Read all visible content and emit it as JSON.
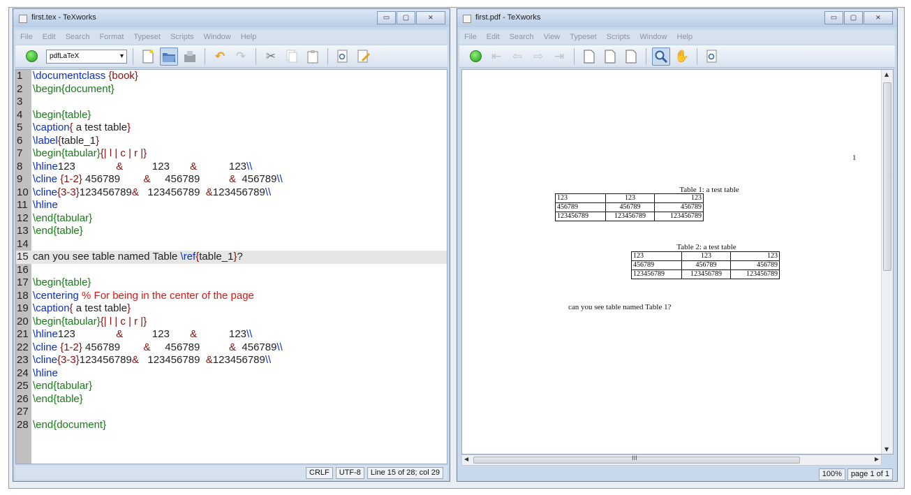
{
  "left": {
    "title": "first.tex - TeXworks",
    "menus": [
      "File",
      "Edit",
      "Search",
      "Format",
      "Typeset",
      "Scripts",
      "Window",
      "Help"
    ],
    "engine": "pdfLaTeX",
    "status": {
      "eol": "CRLF",
      "encoding": "UTF-8",
      "position": "Line 15 of 28; col 29"
    },
    "line_numbers": [
      "1",
      "2",
      "3",
      "4",
      "5",
      "6",
      "7",
      "8",
      "9",
      "10",
      "11",
      "12",
      "13",
      "14",
      "15",
      "16",
      "17",
      "18",
      "19",
      "20",
      "21",
      "22",
      "23",
      "24",
      "25",
      "26",
      "27",
      "28"
    ],
    "code": [
      [
        {
          "t": "\\documentclass ",
          "c": "k"
        },
        {
          "t": "{book}",
          "c": "a"
        }
      ],
      [
        {
          "t": "\\begin",
          "c": "e"
        },
        {
          "t": "{document}",
          "c": "e"
        }
      ],
      [],
      [
        {
          "t": "\\begin",
          "c": "e"
        },
        {
          "t": "{table}",
          "c": "e"
        }
      ],
      [
        {
          "t": "\\caption",
          "c": "k"
        },
        {
          "t": "{",
          "c": "a"
        },
        {
          "t": " a test table",
          "c": "t"
        },
        {
          "t": "}",
          "c": "a"
        }
      ],
      [
        {
          "t": "\\label",
          "c": "k"
        },
        {
          "t": "{",
          "c": "a"
        },
        {
          "t": "table_1",
          "c": "t"
        },
        {
          "t": "}",
          "c": "a"
        }
      ],
      [
        {
          "t": "\\begin",
          "c": "e"
        },
        {
          "t": "{tabular}",
          "c": "e"
        },
        {
          "t": "{| l | c | r |}",
          "c": "a"
        }
      ],
      [
        {
          "t": "\\hline",
          "c": "k"
        },
        {
          "t": "123              ",
          "c": "t"
        },
        {
          "t": "&",
          "c": "a"
        },
        {
          "t": "          123       ",
          "c": "t"
        },
        {
          "t": "&",
          "c": "a"
        },
        {
          "t": "           123",
          "c": "t"
        },
        {
          "t": "\\\\",
          "c": "k"
        }
      ],
      [
        {
          "t": "\\cline ",
          "c": "k"
        },
        {
          "t": "{1-2}",
          "c": "a"
        },
        {
          "t": " 456789        ",
          "c": "t"
        },
        {
          "t": "&",
          "c": "a"
        },
        {
          "t": "     456789          ",
          "c": "t"
        },
        {
          "t": "&",
          "c": "a"
        },
        {
          "t": "  456789",
          "c": "t"
        },
        {
          "t": "\\\\",
          "c": "k"
        }
      ],
      [
        {
          "t": "\\cline",
          "c": "k"
        },
        {
          "t": "{3-3}",
          "c": "a"
        },
        {
          "t": "123456789",
          "c": "t"
        },
        {
          "t": "&",
          "c": "a"
        },
        {
          "t": "   123456789  ",
          "c": "t"
        },
        {
          "t": "&",
          "c": "a"
        },
        {
          "t": "123456789",
          "c": "t"
        },
        {
          "t": "\\\\",
          "c": "k"
        }
      ],
      [
        {
          "t": "\\hline",
          "c": "k"
        }
      ],
      [
        {
          "t": "\\end",
          "c": "e"
        },
        {
          "t": "{tabular}",
          "c": "e"
        }
      ],
      [
        {
          "t": "\\end",
          "c": "e"
        },
        {
          "t": "{table}",
          "c": "e"
        }
      ],
      [],
      [
        {
          "t": "can you see table named Table ",
          "c": "t"
        },
        {
          "t": "\\ref",
          "c": "k"
        },
        {
          "t": "{",
          "c": "a"
        },
        {
          "t": "table_1",
          "c": "t"
        },
        {
          "t": "}",
          "c": "a"
        },
        {
          "t": "?",
          "c": "t"
        }
      ],
      [],
      [
        {
          "t": "\\begin",
          "c": "e"
        },
        {
          "t": "{table}",
          "c": "e"
        }
      ],
      [
        {
          "t": "\\centering ",
          "c": "k"
        },
        {
          "t": "% For being in the center of the page",
          "c": "c"
        }
      ],
      [
        {
          "t": "\\caption",
          "c": "k"
        },
        {
          "t": "{",
          "c": "a"
        },
        {
          "t": " a test table",
          "c": "t"
        },
        {
          "t": "}",
          "c": "a"
        }
      ],
      [
        {
          "t": "\\begin",
          "c": "e"
        },
        {
          "t": "{tabular}",
          "c": "e"
        },
        {
          "t": "{| l | c | r |}",
          "c": "a"
        }
      ],
      [
        {
          "t": "\\hline",
          "c": "k"
        },
        {
          "t": "123              ",
          "c": "t"
        },
        {
          "t": "&",
          "c": "a"
        },
        {
          "t": "          123       ",
          "c": "t"
        },
        {
          "t": "&",
          "c": "a"
        },
        {
          "t": "           123",
          "c": "t"
        },
        {
          "t": "\\\\",
          "c": "k"
        }
      ],
      [
        {
          "t": "\\cline ",
          "c": "k"
        },
        {
          "t": "{1-2}",
          "c": "a"
        },
        {
          "t": " 456789        ",
          "c": "t"
        },
        {
          "t": "&",
          "c": "a"
        },
        {
          "t": "     456789          ",
          "c": "t"
        },
        {
          "t": "&",
          "c": "a"
        },
        {
          "t": "  456789",
          "c": "t"
        },
        {
          "t": "\\\\",
          "c": "k"
        }
      ],
      [
        {
          "t": "\\cline",
          "c": "k"
        },
        {
          "t": "{3-3}",
          "c": "a"
        },
        {
          "t": "123456789",
          "c": "t"
        },
        {
          "t": "&",
          "c": "a"
        },
        {
          "t": "   123456789  ",
          "c": "t"
        },
        {
          "t": "&",
          "c": "a"
        },
        {
          "t": "123456789",
          "c": "t"
        },
        {
          "t": "\\\\",
          "c": "k"
        }
      ],
      [
        {
          "t": "\\hline",
          "c": "k"
        }
      ],
      [
        {
          "t": "\\end",
          "c": "e"
        },
        {
          "t": "{tabular}",
          "c": "e"
        }
      ],
      [
        {
          "t": "\\end",
          "c": "e"
        },
        {
          "t": "{table}",
          "c": "e"
        }
      ],
      [],
      [
        {
          "t": "\\end",
          "c": "e"
        },
        {
          "t": "{document}",
          "c": "e"
        }
      ]
    ],
    "current_line": 15
  },
  "right": {
    "title": "first.pdf - TeXworks",
    "menus": [
      "File",
      "Edit",
      "Search",
      "View",
      "Typeset",
      "Scripts",
      "Window",
      "Help"
    ],
    "scroll_middle": "III",
    "status": {
      "zoom": "100%",
      "page": "page 1 of 1"
    },
    "pdf": {
      "page_number": "1",
      "table1": {
        "caption": "Table 1: a test table",
        "rows": [
          [
            "123",
            "123",
            "123"
          ],
          [
            "456789",
            "456789",
            "456789"
          ],
          [
            "123456789",
            "123456789",
            "123456789"
          ]
        ]
      },
      "table2": {
        "caption": "Table 2: a test table",
        "rows": [
          [
            "123",
            "123",
            "123"
          ],
          [
            "456789",
            "456789",
            "456789"
          ],
          [
            "123456789",
            "123456789",
            "123456789"
          ]
        ]
      },
      "sentence": "can you see table named Table 1?"
    }
  },
  "window_buttons": {
    "minimize": "▭",
    "maximize": "▢",
    "close": "⨯"
  },
  "colors": {
    "command": "#0c2ec8",
    "environment": "#1a7a1a",
    "argument": "#8b0f0f",
    "comment": "#e41414"
  }
}
